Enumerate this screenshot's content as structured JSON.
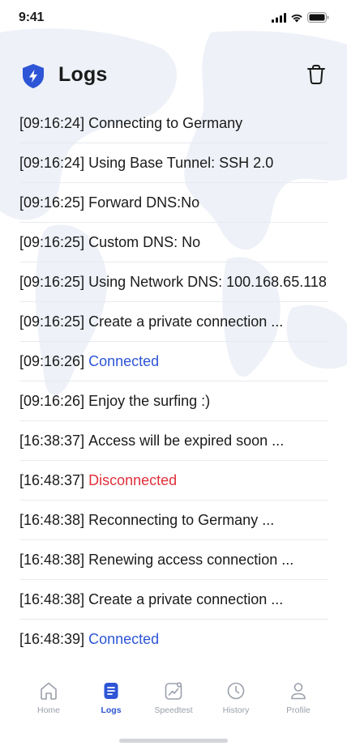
{
  "status_bar": {
    "time": "9:41"
  },
  "header": {
    "title": "Logs"
  },
  "logs": [
    {
      "time": "[09:16:24]",
      "message": "Connecting to Germany",
      "tone": "normal"
    },
    {
      "time": "[09:16:24]",
      "message": "Using Base Tunnel: SSH 2.0",
      "tone": "normal"
    },
    {
      "time": "[09:16:25]",
      "message": "Forward DNS:No",
      "tone": "normal"
    },
    {
      "time": "[09:16:25]",
      "message": "Custom DNS: No",
      "tone": "normal"
    },
    {
      "time": "[09:16:25]",
      "message": "Using Network DNS: 100.168.65.118",
      "tone": "normal"
    },
    {
      "time": "[09:16:25]",
      "message": "Create a private connection ...",
      "tone": "normal"
    },
    {
      "time": "[09:16:26]",
      "message": "Connected",
      "tone": "blue"
    },
    {
      "time": "[09:16:26]",
      "message": "Enjoy the surfing :)",
      "tone": "normal"
    },
    {
      "time": "[16:38:37]",
      "message": "Access will be expired soon ...",
      "tone": "normal"
    },
    {
      "time": "[16:48:37]",
      "message": "Disconnected",
      "tone": "red"
    },
    {
      "time": "[16:48:38]",
      "message": "Reconnecting to Germany ...",
      "tone": "normal"
    },
    {
      "time": "[16:48:38]",
      "message": "Renewing access connection ...",
      "tone": "normal"
    },
    {
      "time": "[16:48:38]",
      "message": "Create a private connection ...",
      "tone": "normal"
    },
    {
      "time": "[16:48:39]",
      "message": "Connected",
      "tone": "blue"
    }
  ],
  "tabs": [
    {
      "label": "Home",
      "icon": "home-icon",
      "active": false
    },
    {
      "label": "Logs",
      "icon": "logs-icon",
      "active": true
    },
    {
      "label": "Speedtest",
      "icon": "speedtest-icon",
      "active": false
    },
    {
      "label": "History",
      "icon": "history-icon",
      "active": false
    },
    {
      "label": "Profile",
      "icon": "profile-icon",
      "active": false
    }
  ],
  "colors": {
    "accent": "#2d55d6",
    "error": "#e0303a",
    "divider": "#e8eaf0",
    "inactive": "#9aa0ab"
  }
}
